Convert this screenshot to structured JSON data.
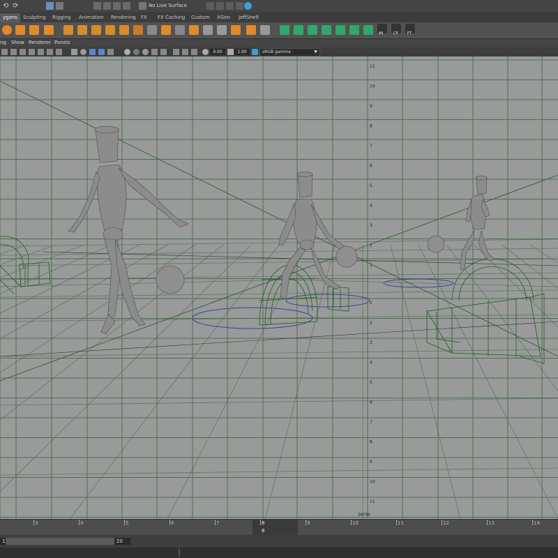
{
  "status_line": {
    "live_surface_label": "No Live Surface"
  },
  "shelf_tabs": [
    {
      "label": "ygons",
      "active": true
    },
    {
      "label": "Sculpting"
    },
    {
      "label": "Rigging"
    },
    {
      "label": "Animation"
    },
    {
      "label": "Rendering"
    },
    {
      "label": "FX"
    },
    {
      "label": "FX Caching"
    },
    {
      "label": "Custom"
    },
    {
      "label": "XGen"
    },
    {
      "label": "JeffShelf"
    }
  ],
  "shelf": {
    "all_label": "All",
    "cp_label": "CP",
    "ft_label": "FT"
  },
  "panel_menu": [
    "ng",
    "Show",
    "Renderer",
    "Panels"
  ],
  "panel_toolbar": {
    "exposure_value": "0.00",
    "gamma_value": "1.00",
    "color_management": "sRGB gamma"
  },
  "viewport": {
    "camera_label": "persp",
    "grid_labels_upper": [
      "11",
      "10",
      "9",
      "8",
      "7",
      "6",
      "5",
      "4",
      "3",
      "2",
      "1"
    ],
    "grid_labels_lower": [
      "1",
      "2",
      "3",
      "4",
      "5",
      "6",
      "7",
      "8",
      "9",
      "10",
      "11"
    ]
  },
  "time_slider": {
    "tick_labels": [
      "3",
      "4",
      "5",
      "6",
      "7",
      "8",
      "9",
      "10",
      "11",
      "12",
      "13",
      "14"
    ],
    "current_frame": "8",
    "current_frame_sub": "8"
  },
  "range_slider": {
    "start_value": "1",
    "end_value": "20"
  },
  "colors": {
    "viewport_bg": "#999a9a",
    "grid_line": "#3e6b3e",
    "wireframe": "#1d5e1d",
    "selection_circle": "#4040a0",
    "mannequin": "#8a8a8a"
  }
}
